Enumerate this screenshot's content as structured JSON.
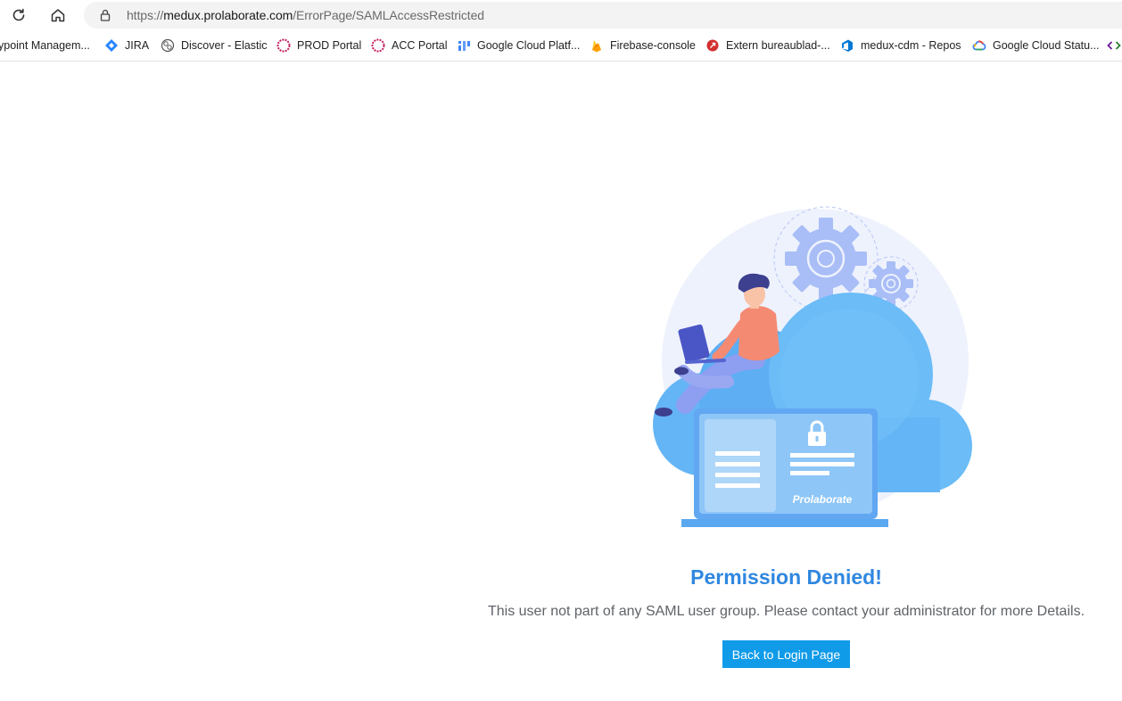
{
  "browser": {
    "url_scheme": "https://",
    "url_host": "medux.prolaborate.com",
    "url_path": "/ErrorPage/SAMLAccessRestricted"
  },
  "bookmarks": [
    {
      "label": "ypoint Managem...",
      "icon": "anypoint-icon"
    },
    {
      "label": "JIRA",
      "icon": "jira-icon"
    },
    {
      "label": "Discover - Elastic",
      "icon": "elastic-icon"
    },
    {
      "label": "PROD Portal",
      "icon": "portal-icon"
    },
    {
      "label": "ACC Portal",
      "icon": "portal-icon"
    },
    {
      "label": "Google Cloud Platf...",
      "icon": "gcp-icon"
    },
    {
      "label": "Firebase-console",
      "icon": "firebase-icon"
    },
    {
      "label": "Extern bureaublad-...",
      "icon": "extern-icon"
    },
    {
      "label": "medux-cdm - Repos",
      "icon": "azure-repos-icon"
    },
    {
      "label": "Google Cloud Statu...",
      "icon": "google-cloud-icon"
    }
  ],
  "page": {
    "illustration_brand": "Prolaborate",
    "title": "Permission Denied!",
    "message": "This user not part of any SAML user group. Please contact your administrator for more Details.",
    "button_label": "Back to Login Page"
  },
  "colors": {
    "title": "#2f87e0",
    "button": "#109be8",
    "cloud": "#64b5f6"
  }
}
